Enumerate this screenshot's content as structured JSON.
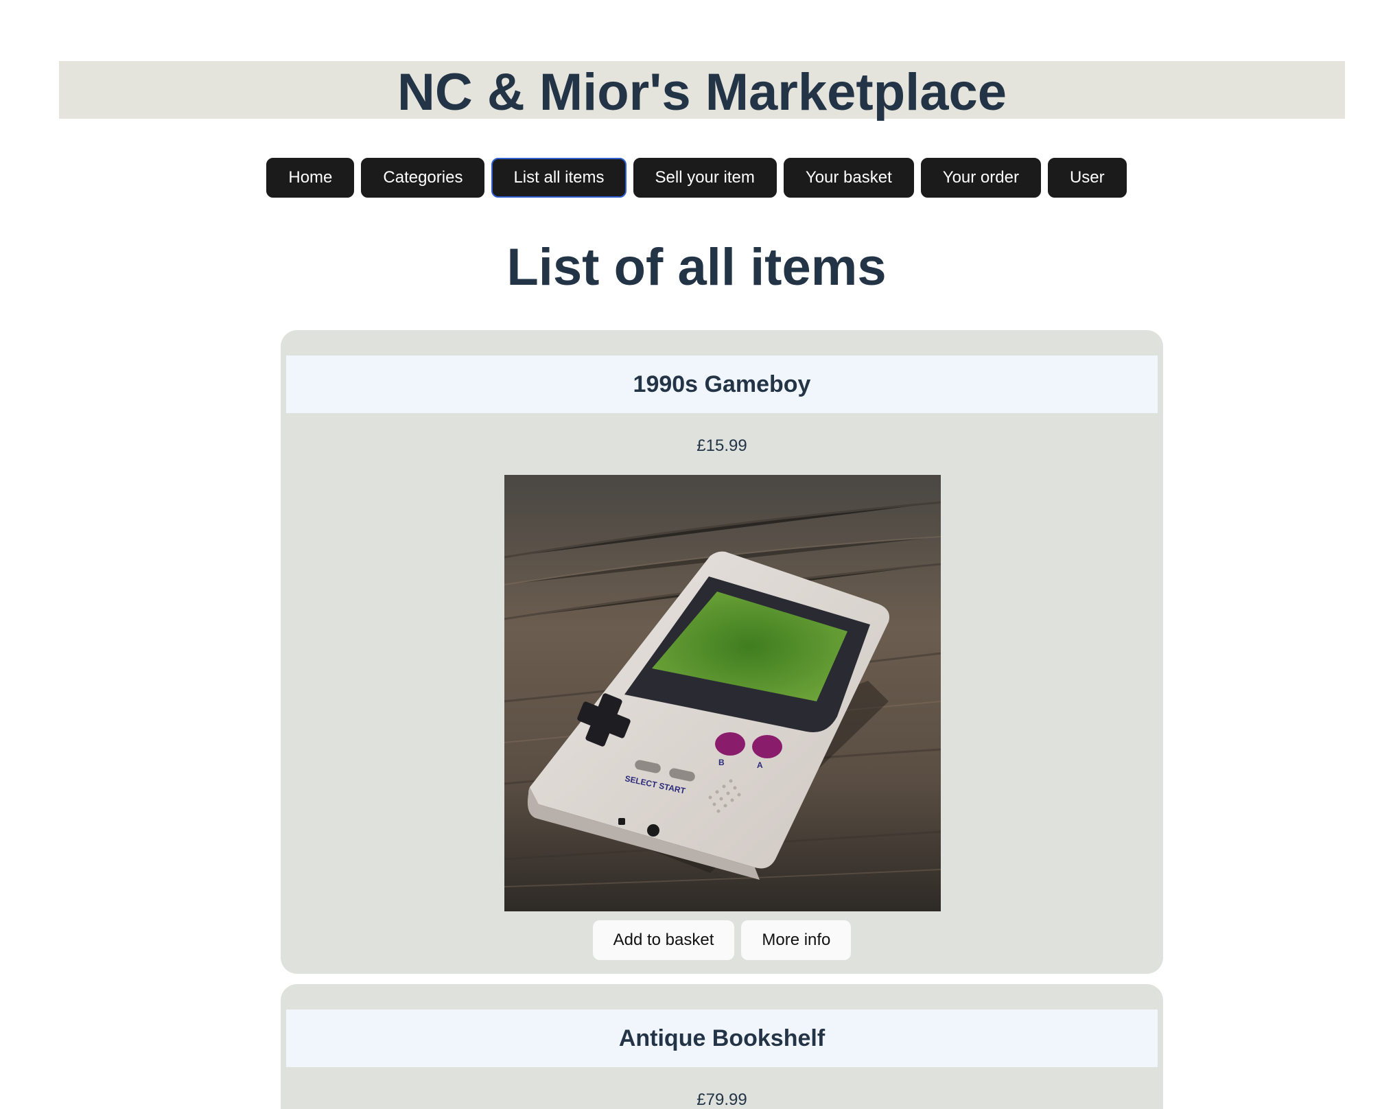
{
  "site": {
    "title": "NC & Mior's Marketplace"
  },
  "nav": {
    "items": [
      {
        "label": "Home"
      },
      {
        "label": "Categories"
      },
      {
        "label": "List all items",
        "active": true
      },
      {
        "label": "Sell your item"
      },
      {
        "label": "Your basket"
      },
      {
        "label": "Your order"
      },
      {
        "label": "User"
      }
    ]
  },
  "main": {
    "heading": "List of all items",
    "items": [
      {
        "name": "1990s Gameboy",
        "price": "£15.99",
        "image_alt": "gameboy-photo",
        "add_label": "Add to basket",
        "info_label": "More info"
      },
      {
        "name": "Antique Bookshelf",
        "price": "£79.99"
      }
    ]
  },
  "colors": {
    "heading": "#243447",
    "header_bg": "#e4e4dc",
    "card_bg": "#dfe1dc",
    "card_title_bg": "#f0f6fc",
    "nav_bg": "#1b1b1b",
    "active_outline": "#2f5fd0"
  }
}
